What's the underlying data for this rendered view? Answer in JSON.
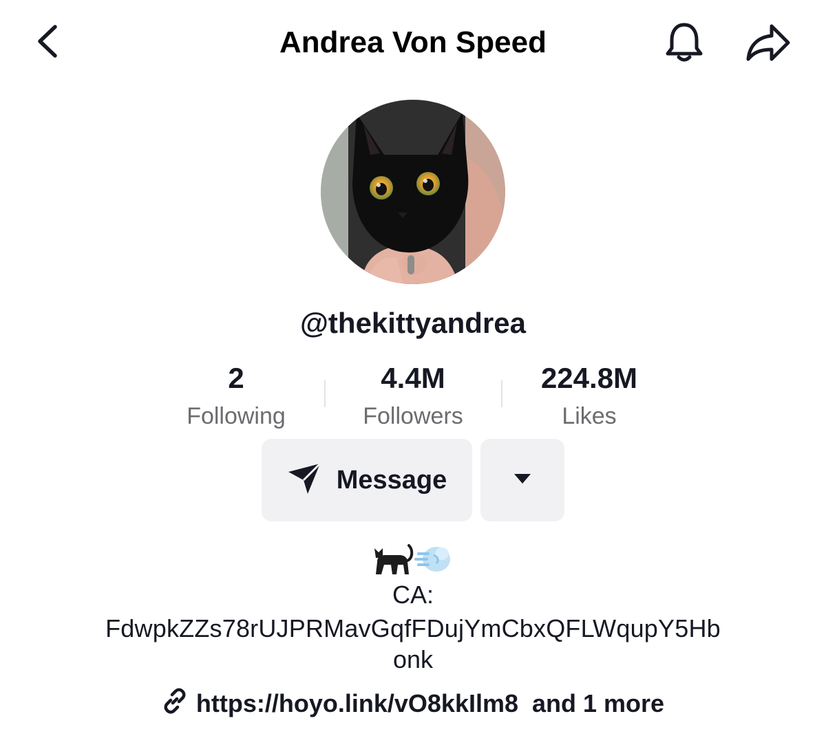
{
  "header": {
    "title": "Andrea Von Speed",
    "icons": {
      "back": "chevron-left-icon",
      "bell": "bell-icon",
      "share": "share-arrow-icon"
    }
  },
  "profile": {
    "avatar": "black-cat-avatar",
    "handle": "@thekittyandrea"
  },
  "stats": [
    {
      "value": "2",
      "label": "Following"
    },
    {
      "value": "4.4M",
      "label": "Followers"
    },
    {
      "value": "224.8M",
      "label": "Likes"
    }
  ],
  "actions": {
    "message_label": "Message",
    "message_icon": "send-icon",
    "dropdown_icon": "caret-down-icon"
  },
  "bio": {
    "emojis": [
      "cat-emoji",
      "dash-emoji"
    ],
    "line1": "CA:",
    "line2": "FdwpkZZs78rUJPRMavGqfFDujYmCbxQFLWqupY5Hb",
    "line3": "onk"
  },
  "link": {
    "icon": "link-icon",
    "url": "https://hoyo.link/vO8kkIlm8",
    "more": "and 1 more"
  },
  "colors": {
    "text": "#161823",
    "muted": "#6b6b70",
    "button_bg": "#f1f1f3"
  }
}
